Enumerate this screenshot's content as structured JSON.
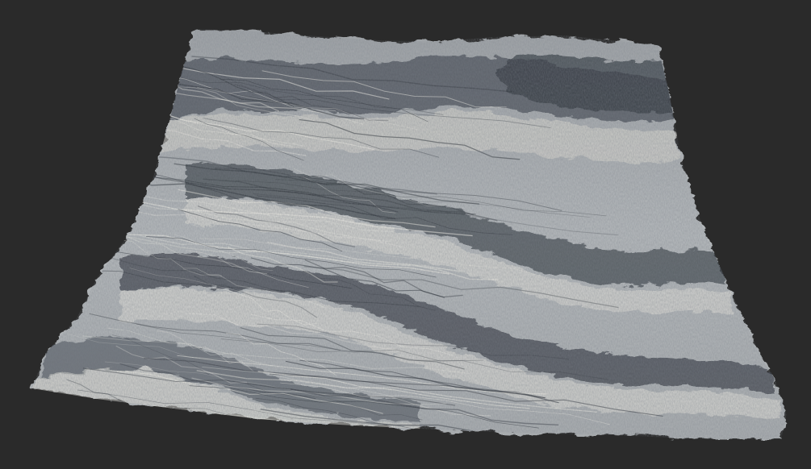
{
  "viewport": {
    "background_color": "#2a2a2a"
  },
  "terrain": {
    "kind": "3d-heightmap-terrain-render",
    "base_color": "#a9adb0",
    "shadow_color": "#3a4048",
    "highlight_color": "#e6e4dc",
    "ridge_count": 5
  }
}
